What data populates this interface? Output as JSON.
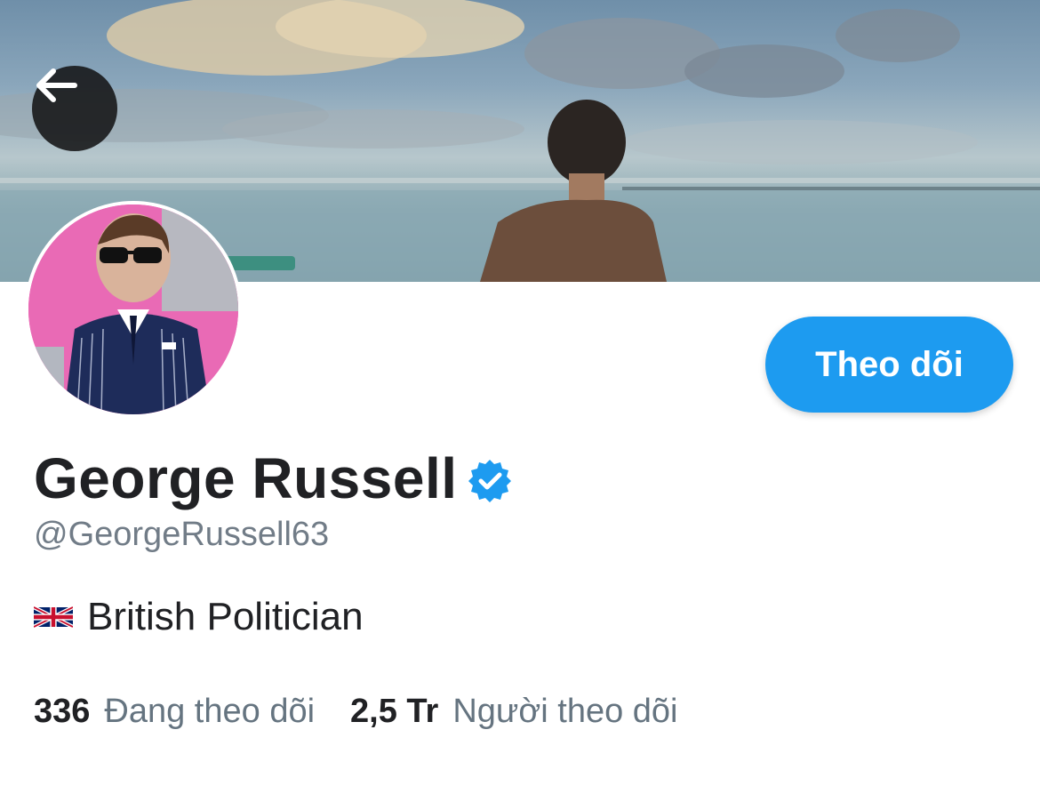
{
  "profile": {
    "display_name": "George Russell",
    "handle": "@GeorgeRussell63",
    "bio": "British Politician",
    "verified_icon": "verified-badge-icon",
    "flag_icon": "uk-flag-icon"
  },
  "actions": {
    "follow_label": "Theo dõi",
    "back_icon": "arrow-left-icon"
  },
  "stats": {
    "following_count": "336",
    "following_label": "Đang theo dõi",
    "followers_count": "2,5 Tr",
    "followers_label": "Người theo dõi"
  },
  "colors": {
    "accent": "#1d9bf0",
    "text_primary": "#202124",
    "text_secondary": "#717c87"
  }
}
